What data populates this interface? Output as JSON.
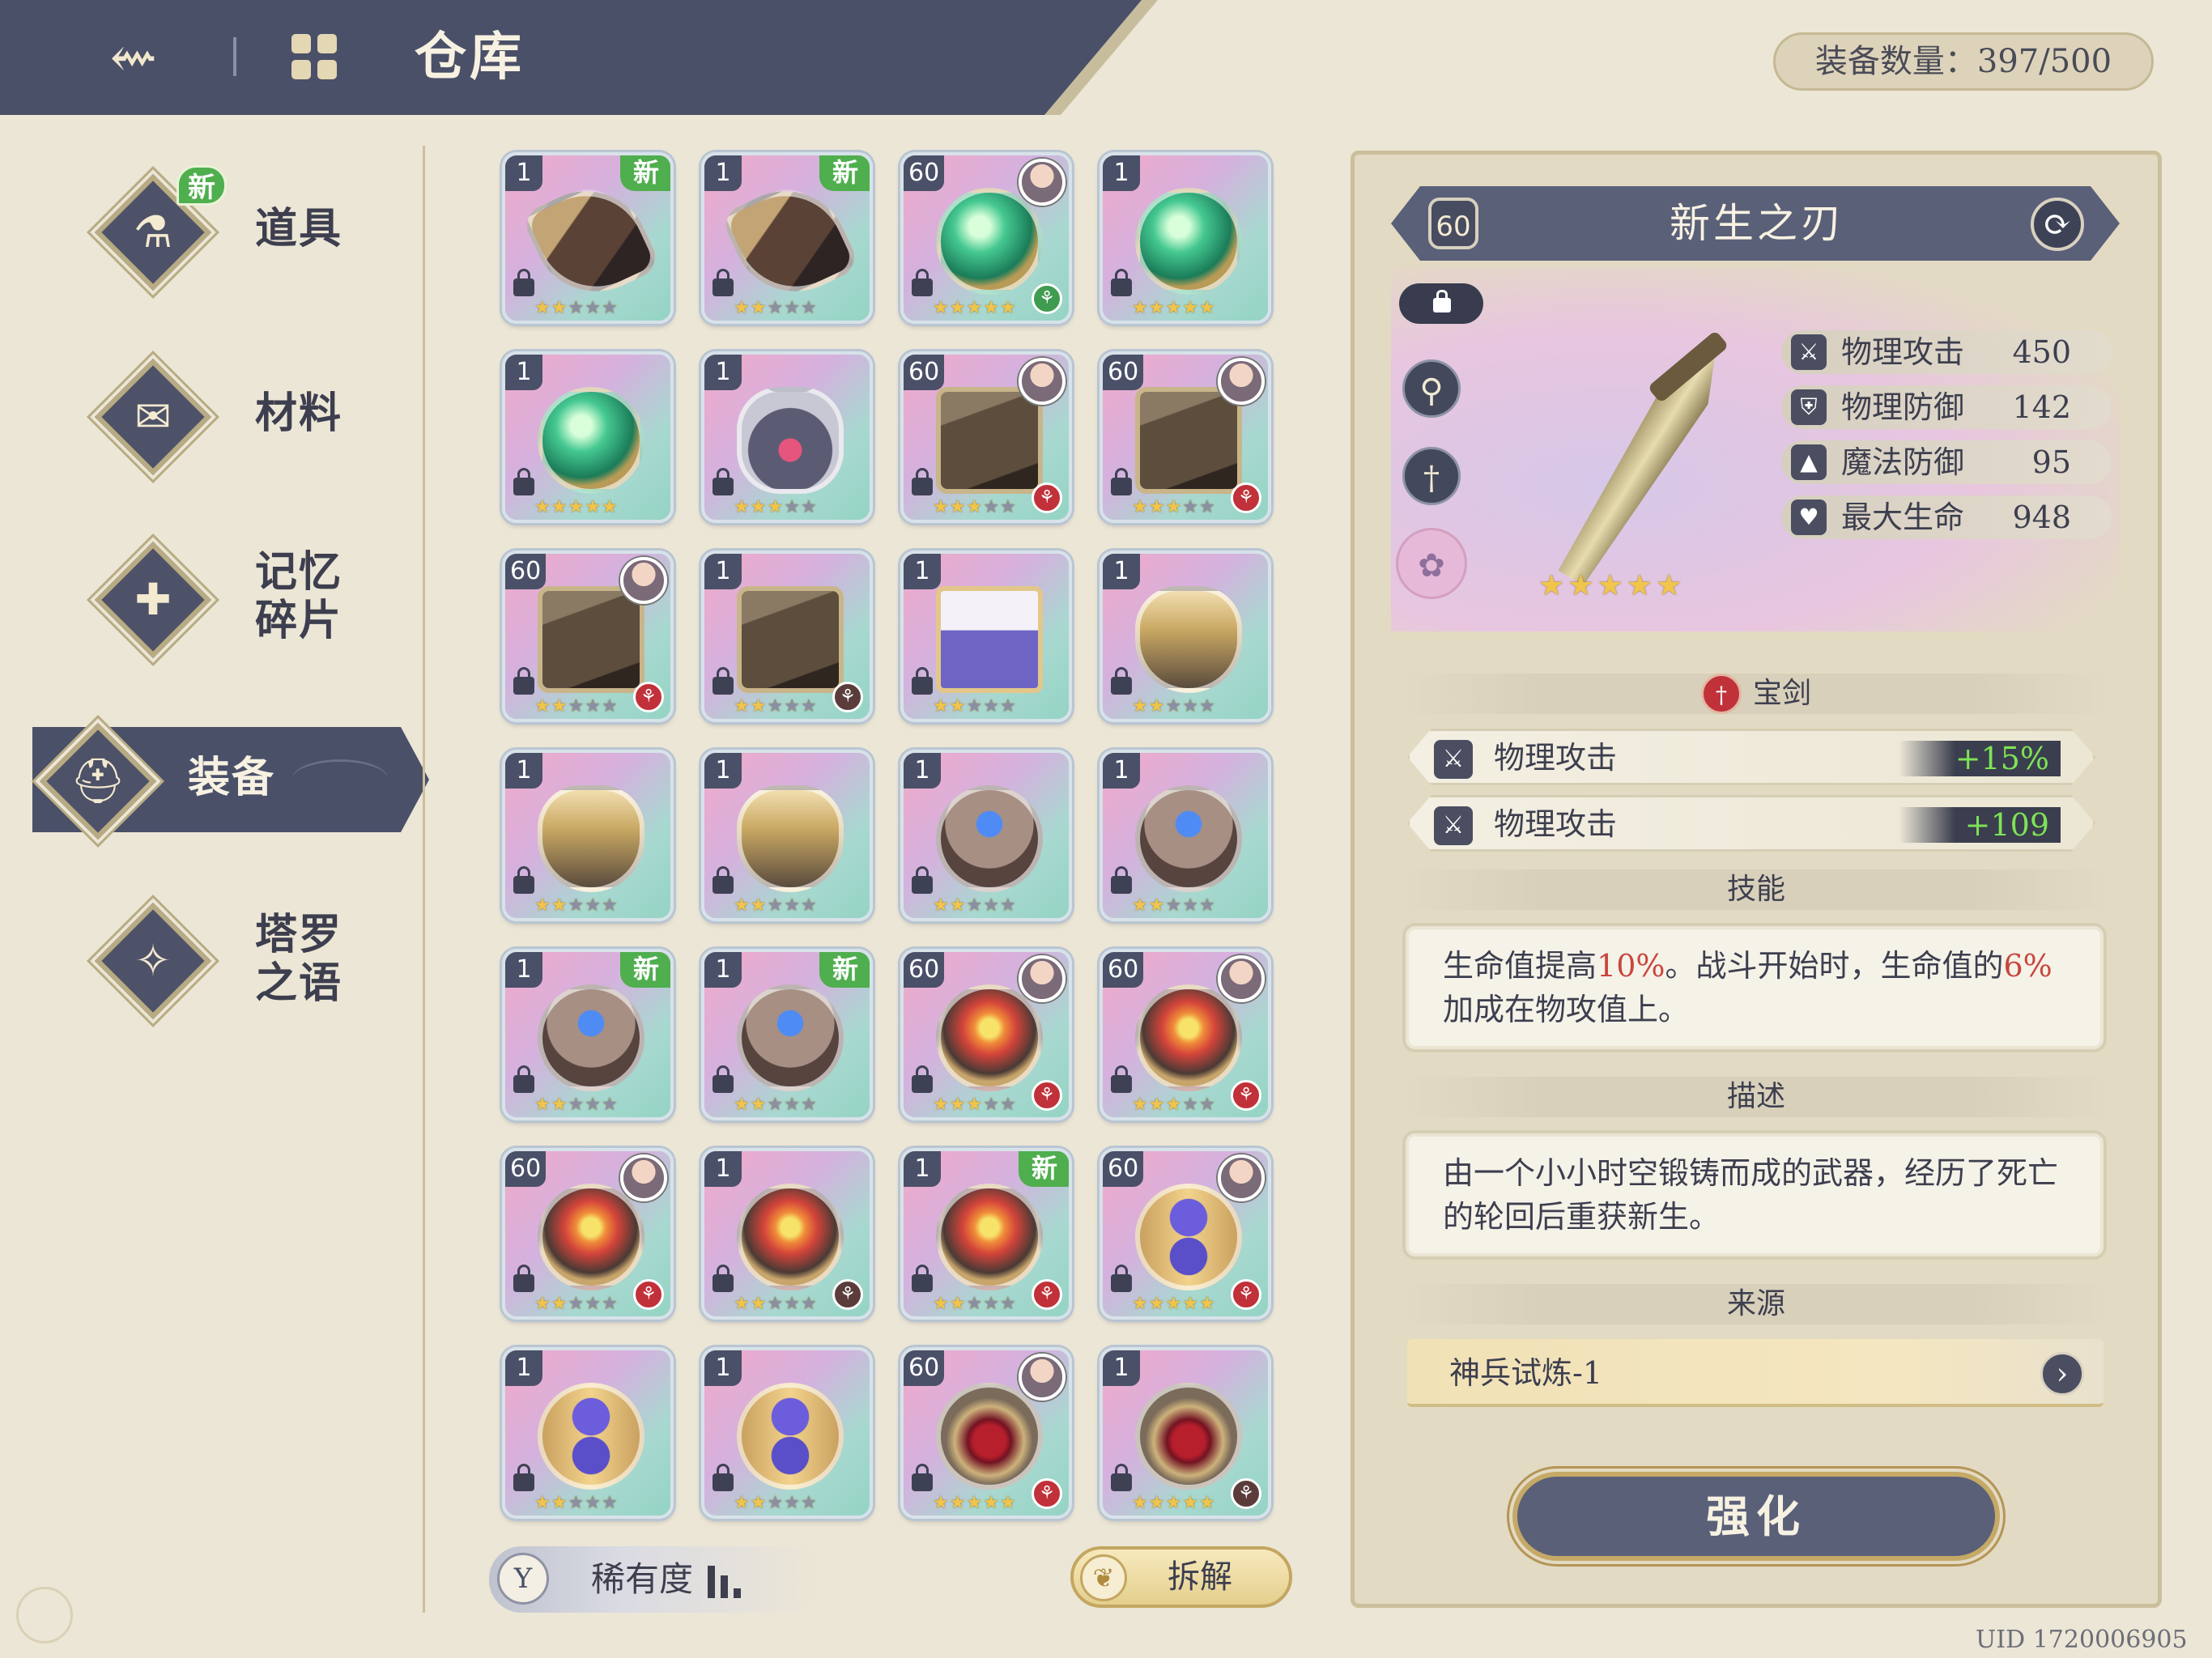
{
  "header": {
    "title": "仓库",
    "equipment_count": "装备数量：397/500"
  },
  "sidebar": {
    "items": [
      {
        "label": "道具",
        "icon": "potion-icon",
        "new_badge": "新",
        "active": false
      },
      {
        "label": "材料",
        "icon": "scroll-icon",
        "active": false
      },
      {
        "label": "记忆\n碎片",
        "line1": "记忆",
        "line2": "碎片",
        "icon": "puzzle-icon",
        "active": false
      },
      {
        "label": "装备",
        "icon": "helmet-icon",
        "active": true
      },
      {
        "label": "塔罗\n之语",
        "line1": "塔罗",
        "line2": "之语",
        "icon": "tarot-icon",
        "active": false
      }
    ]
  },
  "grid": {
    "items": [
      {
        "level": "1",
        "new": "新",
        "art": "gauntlet",
        "stars": 5,
        "lit_stars": 2
      },
      {
        "level": "1",
        "new": "新",
        "art": "gauntlet",
        "stars": 5,
        "lit_stars": 2
      },
      {
        "level": "60",
        "art": "orb",
        "stars": 5,
        "lit_stars": 5,
        "owner": true,
        "emblem": "green"
      },
      {
        "level": "1",
        "art": "orb",
        "stars": 5,
        "lit_stars": 5
      },
      {
        "level": "1",
        "art": "orb",
        "stars": 5,
        "lit_stars": 5
      },
      {
        "level": "1",
        "art": "keychain",
        "stars": 5,
        "lit_stars": 3
      },
      {
        "level": "60",
        "art": "book",
        "stars": 5,
        "lit_stars": 3,
        "owner": true,
        "emblem": "red"
      },
      {
        "level": "60",
        "art": "book",
        "stars": 5,
        "lit_stars": 3,
        "owner": true,
        "emblem": "red"
      },
      {
        "level": "60",
        "art": "book",
        "stars": 5,
        "lit_stars": 2,
        "owner": true,
        "emblem": "red"
      },
      {
        "level": "1",
        "art": "book",
        "stars": 5,
        "lit_stars": 2,
        "emblem": "dark"
      },
      {
        "level": "1",
        "art": "card",
        "stars": 5,
        "lit_stars": 2
      },
      {
        "level": "1",
        "art": "shield",
        "stars": 5,
        "lit_stars": 2
      },
      {
        "level": "1",
        "art": "shield",
        "stars": 5,
        "lit_stars": 2
      },
      {
        "level": "1",
        "art": "shield",
        "stars": 5,
        "lit_stars": 2
      },
      {
        "level": "1",
        "art": "ring",
        "stars": 5,
        "lit_stars": 2
      },
      {
        "level": "1",
        "art": "ring",
        "stars": 5,
        "lit_stars": 2
      },
      {
        "level": "1",
        "new": "新",
        "art": "ring",
        "stars": 5,
        "lit_stars": 2
      },
      {
        "level": "1",
        "new": "新",
        "art": "ring",
        "stars": 5,
        "lit_stars": 2
      },
      {
        "level": "60",
        "art": "fire",
        "stars": 5,
        "lit_stars": 3,
        "owner": true,
        "emblem": "red"
      },
      {
        "level": "60",
        "art": "fire",
        "stars": 5,
        "lit_stars": 3,
        "owner": true,
        "emblem": "red"
      },
      {
        "level": "60",
        "art": "fire",
        "stars": 5,
        "lit_stars": 2,
        "owner": true,
        "emblem": "red"
      },
      {
        "level": "1",
        "art": "fire",
        "stars": 5,
        "lit_stars": 2,
        "emblem": "dark"
      },
      {
        "level": "1",
        "new": "新",
        "art": "fire",
        "stars": 5,
        "lit_stars": 2,
        "emblem": "red"
      },
      {
        "level": "60",
        "art": "hourglass",
        "stars": 5,
        "lit_stars": 5,
        "owner": true,
        "emblem": "red"
      },
      {
        "level": "1",
        "art": "hourglass",
        "stars": 5,
        "lit_stars": 2
      },
      {
        "level": "1",
        "art": "hourglass",
        "stars": 5,
        "lit_stars": 2
      },
      {
        "level": "60",
        "art": "crest",
        "stars": 5,
        "lit_stars": 5,
        "owner": true,
        "emblem": "red"
      },
      {
        "level": "1",
        "art": "crest",
        "stars": 5,
        "lit_stars": 5,
        "emblem": "dark"
      }
    ]
  },
  "grid_footer": {
    "rarity_label": "稀有度",
    "dismantle_label": "拆解"
  },
  "detail": {
    "level": "60",
    "name": "新生之刃",
    "stars": "★★★★★",
    "stats": [
      {
        "name": "物理攻击",
        "value": "450",
        "icon": "sword-icon"
      },
      {
        "name": "物理防御",
        "value": "142",
        "icon": "shield-icon"
      },
      {
        "name": "魔法防御",
        "value": "95",
        "icon": "hat-icon"
      },
      {
        "name": "最大生命",
        "value": "948",
        "icon": "heart-icon"
      }
    ],
    "weapon_type": "宝剑",
    "bonuses": [
      {
        "name": "物理攻击",
        "value": "+15%"
      },
      {
        "name": "物理攻击",
        "value": "+109"
      }
    ],
    "skill_header": "技能",
    "skill_parts": {
      "a": "生命值提高",
      "b": "10%",
      "c": "。战斗开始时，生命值的",
      "d": "6%",
      "e": "加成在物攻值上。"
    },
    "description_header": "描述",
    "description": "由一个小小时空锻铸而成的武器，经历了死亡的轮回后重获新生。",
    "source_header": "来源",
    "source": "神兵试炼-1",
    "enhance_label": "强化"
  },
  "uid": "UID 1720006905",
  "colors": {
    "navy": "#4a5068",
    "parchment": "#ece6d6",
    "new_badge": "#4fae4e",
    "bonus_text": "#7ee356",
    "highlight": "#c8463d"
  }
}
